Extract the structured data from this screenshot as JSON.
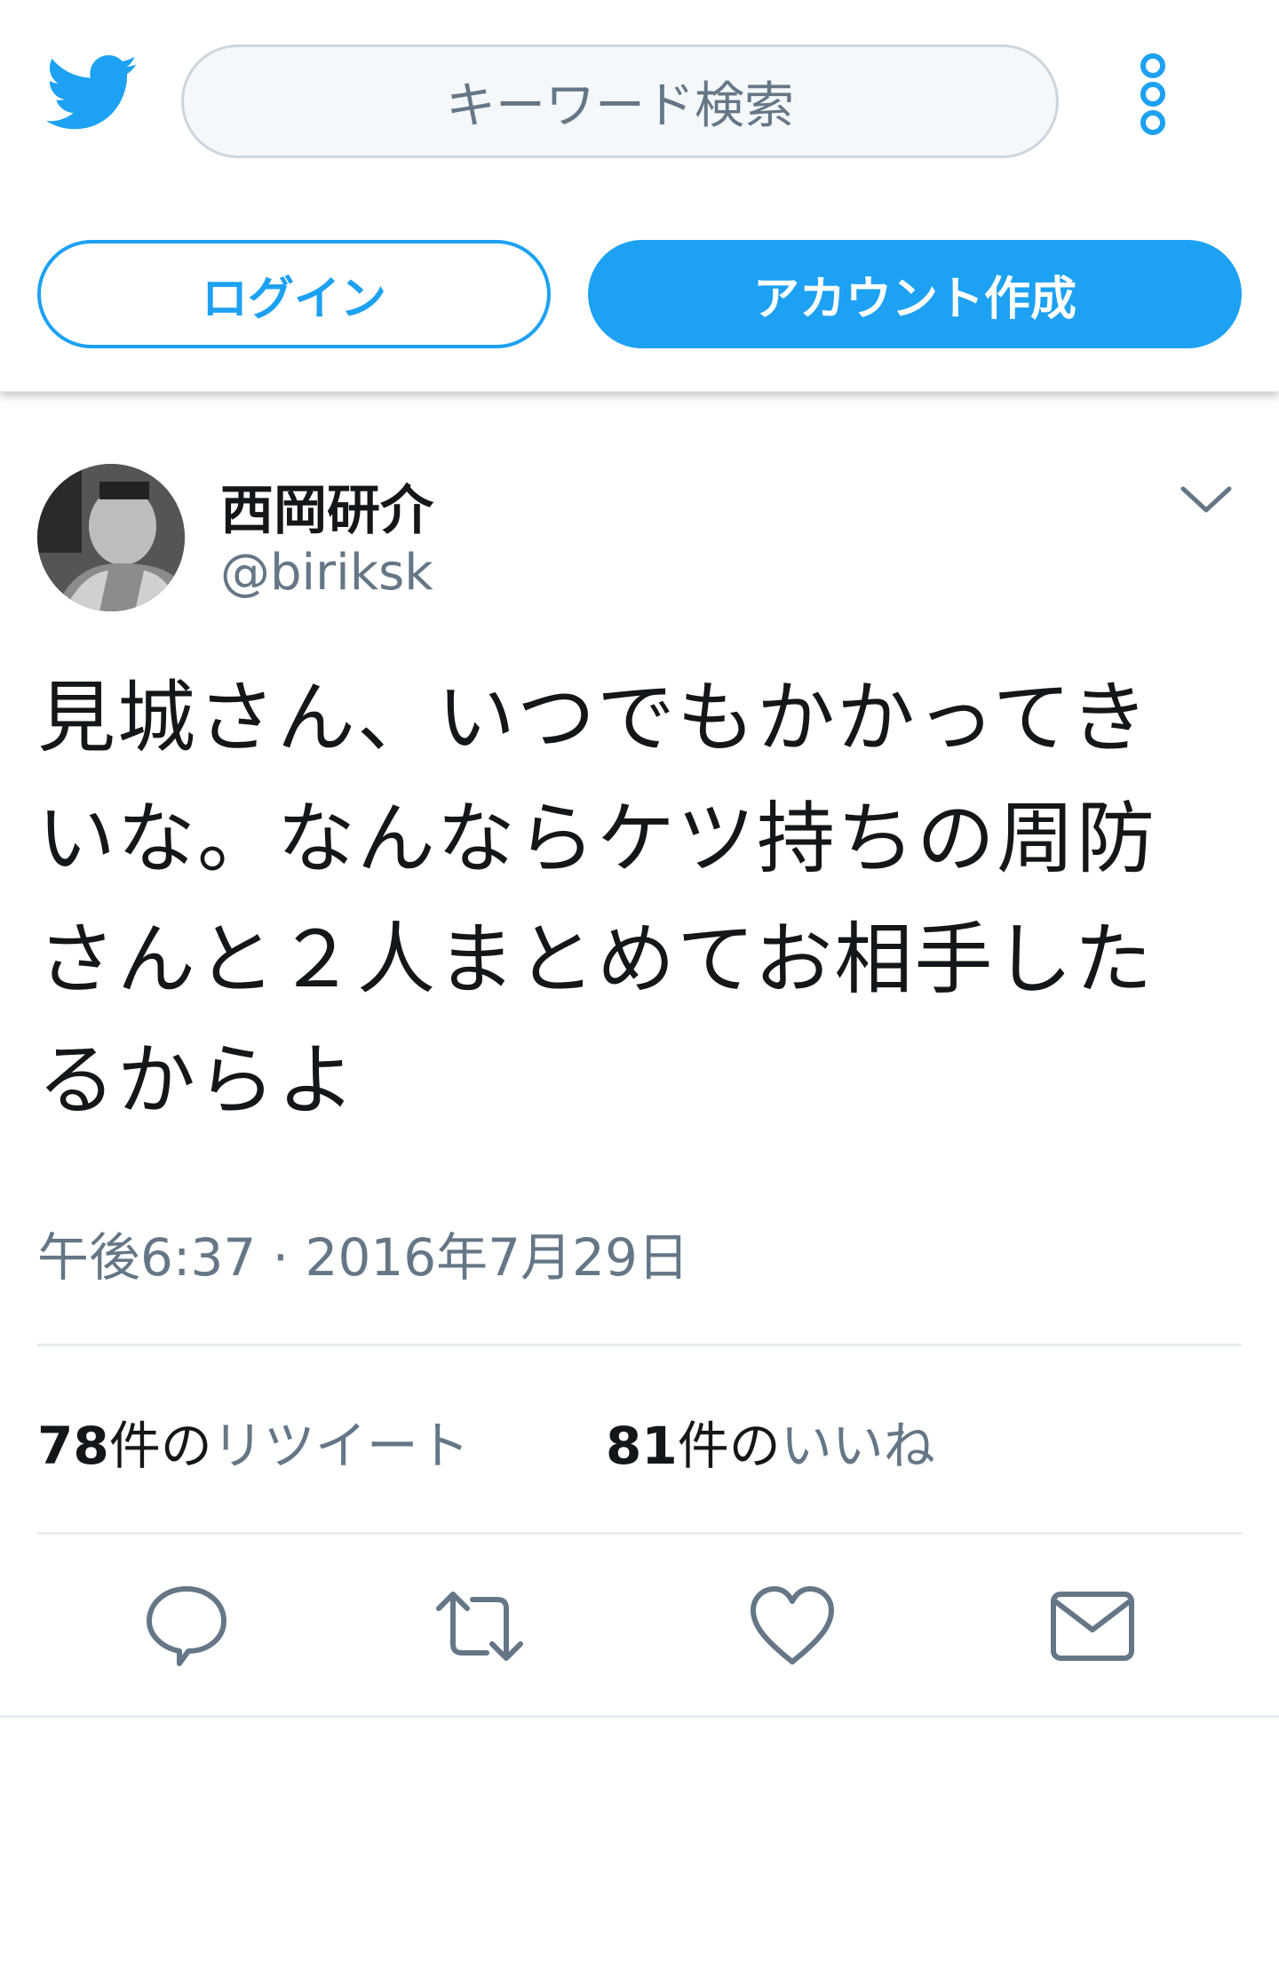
{
  "header": {
    "search_placeholder": "キーワード検索",
    "login_label": "ログイン",
    "signup_label": "アカウント作成"
  },
  "tweet": {
    "display_name": "西岡研介",
    "handle": "@biriksk",
    "text_lines": [
      "見城さん、いつでもかかってき",
      "いな。なんならケツ持ちの周防",
      "さんと２人まとめてお相手した",
      "るからよ"
    ],
    "timestamp": "午後6:37 · 2016年7月29日",
    "retweets": {
      "count": "78",
      "count_suffix": "件の",
      "label": "リツイート"
    },
    "likes": {
      "count": "81",
      "count_suffix": "件の",
      "label": "いいね"
    }
  },
  "colors": {
    "accent": "#1da1f2",
    "secondary_text": "#657786",
    "icon_gray": "#657786",
    "divider": "#e6ecf0"
  },
  "icons": [
    "twitter-bird-icon",
    "more-options-icon",
    "chevron-down-icon",
    "reply-icon",
    "retweet-icon",
    "like-icon",
    "share-mail-icon"
  ]
}
